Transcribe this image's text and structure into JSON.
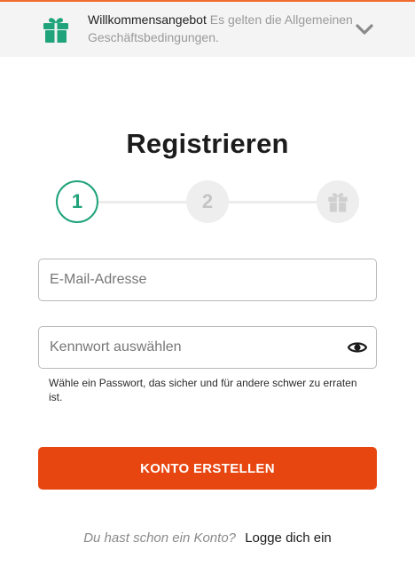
{
  "banner": {
    "title": "Willkommensangebot",
    "description": "Es gelten die Allgemeinen Geschäftsbedingungen.",
    "gift_icon": "gift-icon",
    "expand_icon": "chevron-down-icon",
    "accent_color": "#1fa37a"
  },
  "page": {
    "title": "Registrieren"
  },
  "stepper": {
    "current_step": 1,
    "steps": [
      {
        "label": "1",
        "state": "active"
      },
      {
        "label": "2",
        "state": "inactive"
      },
      {
        "label": "",
        "state": "inactive",
        "icon": "gift-icon"
      }
    ]
  },
  "form": {
    "email": {
      "value": "",
      "placeholder": "E-Mail-Adresse"
    },
    "password": {
      "value": "",
      "placeholder": "Kennwort auswählen",
      "toggle_icon": "eye-icon"
    },
    "password_hint": "Wähle ein Passwort, das sicher und für andere schwer zu erraten ist.",
    "submit_label": "KONTO ERSTELLEN",
    "submit_color": "#e84610"
  },
  "footer": {
    "question": "Du hast schon ein Konto?",
    "login_link": "Logge dich ein"
  }
}
